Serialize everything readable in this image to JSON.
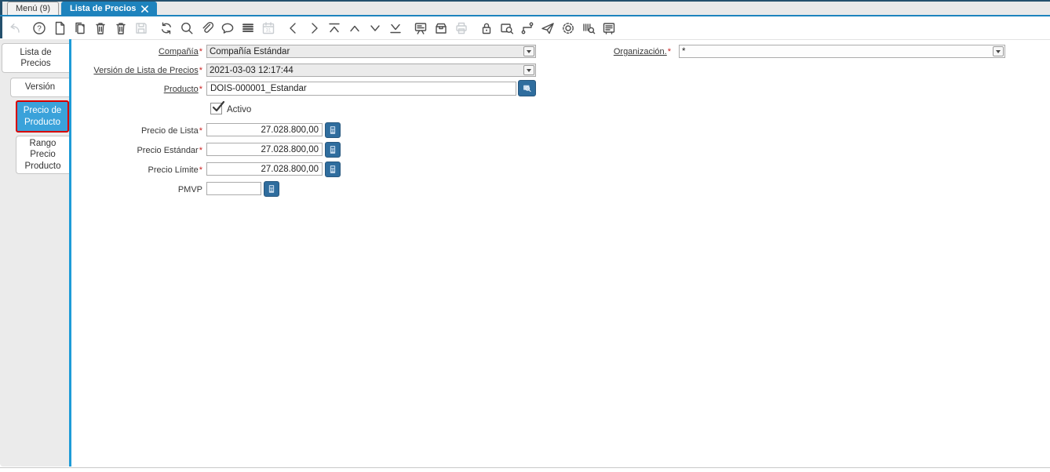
{
  "window": {
    "tabs": [
      {
        "label": "Menú (9)",
        "active": false,
        "closable": false
      },
      {
        "label": "Lista de Precios",
        "active": true,
        "closable": true
      }
    ]
  },
  "toolbar": {
    "buttons": [
      {
        "name": "undo",
        "disabled": true,
        "group_start": false
      },
      {
        "name": "help",
        "disabled": false,
        "group_start": true
      },
      {
        "name": "new-record",
        "disabled": false,
        "group_start": false
      },
      {
        "name": "copy-record",
        "disabled": false,
        "group_start": false
      },
      {
        "name": "delete-record",
        "disabled": false,
        "group_start": false
      },
      {
        "name": "delete-selection",
        "disabled": false,
        "group_start": false
      },
      {
        "name": "save",
        "disabled": true,
        "group_start": false
      },
      {
        "name": "refresh",
        "disabled": false,
        "group_start": true
      },
      {
        "name": "find",
        "disabled": false,
        "group_start": false
      },
      {
        "name": "attachment",
        "disabled": false,
        "group_start": false
      },
      {
        "name": "chat",
        "disabled": false,
        "group_start": false
      },
      {
        "name": "grid-toggle",
        "disabled": false,
        "group_start": false
      },
      {
        "name": "calendar",
        "disabled": true,
        "group_start": false
      },
      {
        "name": "previous-record",
        "disabled": false,
        "group_start": true
      },
      {
        "name": "next-record",
        "disabled": false,
        "group_start": false
      },
      {
        "name": "first-record",
        "disabled": false,
        "group_start": false
      },
      {
        "name": "parent-record",
        "disabled": false,
        "group_start": false
      },
      {
        "name": "detail-record",
        "disabled": false,
        "group_start": false
      },
      {
        "name": "last-record",
        "disabled": false,
        "group_start": false
      },
      {
        "name": "report",
        "disabled": false,
        "group_start": true
      },
      {
        "name": "archive",
        "disabled": false,
        "group_start": false
      },
      {
        "name": "print",
        "disabled": true,
        "group_start": false
      },
      {
        "name": "lock",
        "disabled": false,
        "group_start": true
      },
      {
        "name": "zoom-across",
        "disabled": false,
        "group_start": false
      },
      {
        "name": "workflow",
        "disabled": false,
        "group_start": false
      },
      {
        "name": "send-request",
        "disabled": false,
        "group_start": false
      },
      {
        "name": "preferences",
        "disabled": false,
        "group_start": false
      },
      {
        "name": "product-info",
        "disabled": false,
        "group_start": false
      },
      {
        "name": "quick-form",
        "disabled": false,
        "group_start": false
      }
    ]
  },
  "sidebar": {
    "tabs": [
      {
        "label": "Lista de Precios",
        "active": false
      },
      {
        "label": "Versión",
        "active": false
      },
      {
        "label": "Precio de Producto",
        "active": true
      },
      {
        "label": "Rango Precio Producto",
        "active": false
      }
    ]
  },
  "form": {
    "required_mark": "*",
    "compania": {
      "label": "Compañía",
      "value": "Compañía Estándar",
      "required": true
    },
    "organizacion": {
      "label": "Organización.",
      "value": "*",
      "required": true
    },
    "version": {
      "label": "Versión de Lista de Precios",
      "value": "2021-03-03 12:17:44",
      "required": true
    },
    "producto": {
      "label": "Producto",
      "value": "DOIS-000001_Estandar",
      "required": true
    },
    "activo": {
      "label": "Activo",
      "checked": true
    },
    "precio_lista": {
      "label": "Precio de Lista",
      "value": "27.028.800,00",
      "required": true
    },
    "precio_estandar": {
      "label": "Precio Estándar",
      "value": "27.028.800,00",
      "required": true
    },
    "precio_limite": {
      "label": "Precio Límite",
      "value": "27.028.800,00",
      "required": true
    },
    "pmvp": {
      "label": "PMVP",
      "value": "",
      "required": false
    }
  },
  "colors": {
    "accent_blue": "#1e83bd",
    "sidebar_active_blue": "#3aa2da",
    "sidebar_line_blue": "#1e9bd7",
    "highlight_red": "#d60000",
    "button_blue": "#2f6d9e",
    "chrome_navy": "#24506d"
  }
}
